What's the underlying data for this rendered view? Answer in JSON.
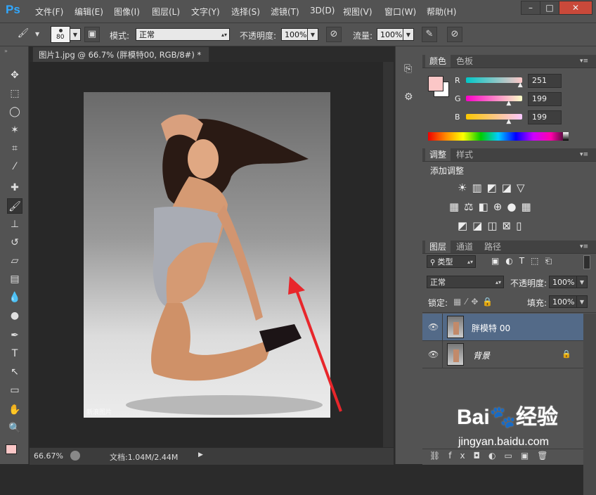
{
  "app": {
    "logo": "Ps"
  },
  "menu": [
    "文件(F)",
    "编辑(E)",
    "图像(I)",
    "图层(L)",
    "文字(Y)",
    "选择(S)",
    "滤镜(T)",
    "3D(D)",
    "视图(V)",
    "窗口(W)",
    "帮助(H)"
  ],
  "window_buttons": {
    "minimize": "–",
    "restore": "□",
    "close": "✕"
  },
  "options": {
    "brush_size": "80",
    "mode_label": "模式:",
    "mode_value": "正常",
    "opacity_label": "不透明度:",
    "opacity_value": "100%",
    "flow_label": "流量:",
    "flow_value": "100%"
  },
  "document": {
    "tab_title": "图片1.jpg @ 66.7% (胖模特00, RGB/8#) *",
    "tab_close": "×",
    "watermark": "新浪图片"
  },
  "status": {
    "zoom": "66.67%",
    "doc_info": "文档:1.04M/2.44M"
  },
  "color_panel": {
    "tabs": [
      "颜色",
      "色板"
    ],
    "channels": [
      {
        "label": "R",
        "value": "251",
        "fraction": 0.984
      },
      {
        "label": "G",
        "value": "199",
        "fraction": 0.78
      },
      {
        "label": "B",
        "value": "199",
        "fraction": 0.78
      }
    ],
    "foreground": "#fbc7c7",
    "background": "#ffffff"
  },
  "adjust_panel": {
    "tabs": [
      "调整",
      "样式"
    ],
    "heading": "添加调整"
  },
  "layers_panel": {
    "tabs": [
      "图层",
      "通道",
      "路径"
    ],
    "filter": "类型",
    "blend_mode": "正常",
    "opacity_label": "不透明度:",
    "opacity_value": "100%",
    "lock_label": "锁定:",
    "fill_label": "填充:",
    "fill_value": "100%",
    "layers": [
      {
        "name": "胖模特 00",
        "selected": true
      },
      {
        "name": "背景",
        "selected": false,
        "locked": true
      }
    ]
  },
  "watermark_baidu": {
    "brand": "Bai",
    "brand2": "du",
    "label": "经验",
    "url": "jingyan.baidu.com"
  },
  "colors": {
    "accent": "#31a8ff",
    "arrow": "#e8262b",
    "selected_layer": "#536a88"
  }
}
